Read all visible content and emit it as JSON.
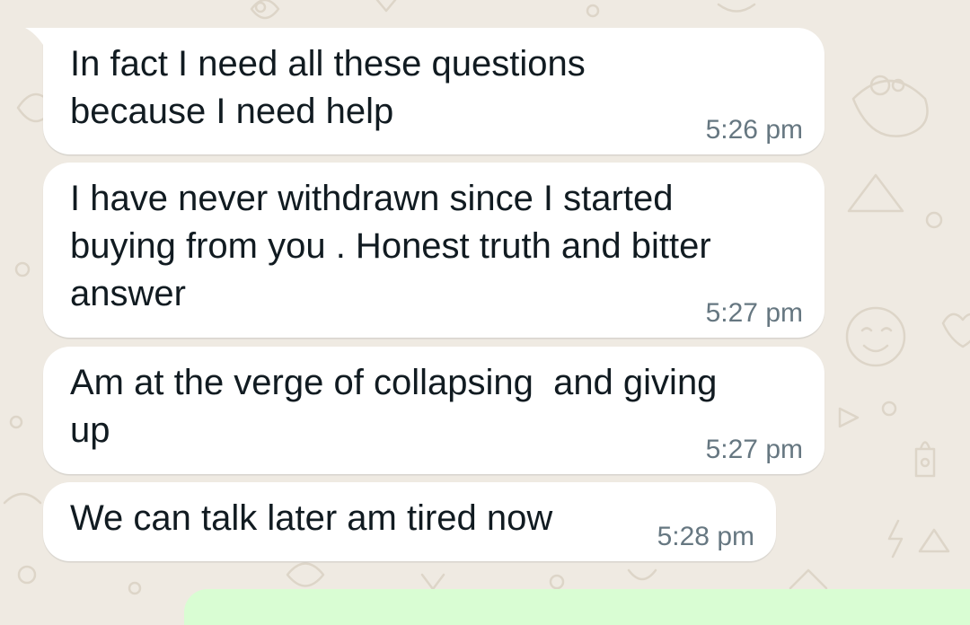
{
  "chat": {
    "messages": [
      {
        "text": "In fact I need all these questions\nbecause I need help",
        "time": "5:26 pm",
        "direction": "incoming"
      },
      {
        "text": "I have never withdrawn since I started\nbuying from you . Honest truth and bitter\nanswer",
        "time": "5:27 pm",
        "direction": "incoming"
      },
      {
        "text": "Am at the verge of collapsing  and giving\nup",
        "time": "5:27 pm",
        "direction": "incoming"
      },
      {
        "text": "We can talk later am tired now",
        "time": "5:28 pm",
        "direction": "incoming"
      }
    ]
  },
  "colors": {
    "wallpaper": "#efeae2",
    "incoming_bubble": "#ffffff",
    "outgoing_bubble": "#d9fdd3",
    "message_text": "#111b21",
    "timestamp_text": "#667781"
  }
}
